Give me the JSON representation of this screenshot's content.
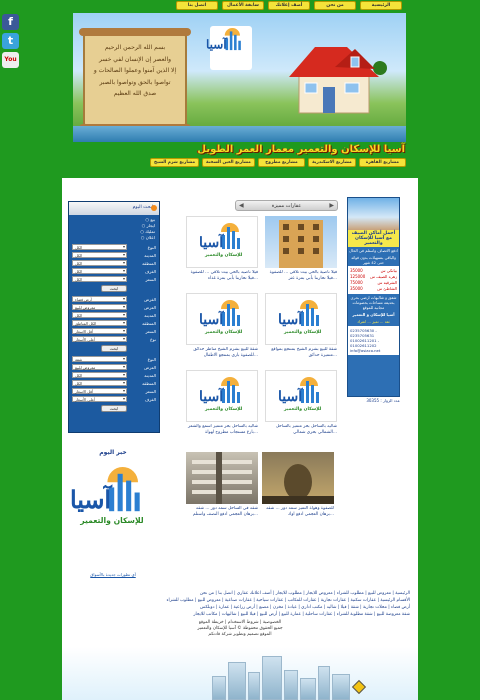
{
  "social": [
    {
      "name": "facebook-icon",
      "glyph": "f"
    },
    {
      "name": "twitter-icon",
      "glyph": "t"
    },
    {
      "name": "youtube-icon",
      "glyph": "You"
    }
  ],
  "top_nav": [
    "الرئيسية",
    "من نحن",
    "أضف إعلانك",
    "سابقة الأعمال",
    "اتصل بنا"
  ],
  "banner": {
    "scroll_text": "بسم الله الرحمن الرحيم\nوالعصر إن الإنسان لفي خسر\nإلا الذين آمنوا وعملوا الصالحات و\nتواصوا بالحق وتواصوا بالصبر\nصدق الله العظيم"
  },
  "tagline": "آسيا للإسكان والتعمير معمار العمر الطويل",
  "project_nav": [
    "مشاريع القاهرة",
    "مشاريع الاسكندرية",
    "مشاريع مطروح",
    "مشاريع العين السخنة",
    "مشاريع شرم الشيخ"
  ],
  "ad": {
    "headline": "أجمل أماكن الصيف مع آسيا للإسكان والتعمير",
    "line1": "ادفع الاتصاف واستلم في الحال",
    "line2": "والباقي بتسهيلات بدون فوائد حتى 42 شهر",
    "prices": [
      {
        "label": "بيانكي س",
        "value": "35000"
      },
      {
        "label": "زهره الصيف س",
        "value": "125000"
      },
      {
        "label": "الشرقيه س",
        "value": "75000"
      },
      {
        "label": "الشاطئ س",
        "value": "35000"
      }
    ],
    "line3": "شقق و شاليهات ارضي بحري بحديقه مساحات بخصومات مجانيه للموقع",
    "company": "آسيا للإسكان و التعمير",
    "motto": "ثقة ... تميز ... انفراد",
    "phones": [
      "0235705630 - 0235705631",
      "01002611201 - 01002611202",
      "info@asiaco.net"
    ]
  },
  "visitors": "عدد الزوار : 30355",
  "listings": {
    "title": "عقارات مميزة",
    "cards": [
      {
        "type": "building",
        "caption": "فيلا ناصية بالحي بيت نلاقي ... للصفوة فيلا تحاربنا بأبي بمرة عثر..."
      },
      {
        "type": "logo",
        "caption": "فيلا ناصيه بالحي بيت نلاقي ... للصفوة فيلا تحاربنا بأبي بمرة غذاء..."
      },
      {
        "type": "logo",
        "caption": "شقة للبيع بشرم الشيخ بمنتجع بمواقع متميزة حدائق..."
      },
      {
        "type": "logo",
        "caption": "شقة للبيع بشرم الشيخ مناظر حدائق للصفوة باري بمنتجع الاطفال..."
      },
      {
        "type": "logo",
        "caption": "شاليه بالساحل بحر متميز بالساحل الشمالي بحري شمالي..."
      },
      {
        "type": "logo",
        "caption": "شاليه بالساحل بحر متميز اسمع والشعر بارع مستجاب مطروح لهواة..."
      },
      {
        "type": "interior",
        "caption": "للصفوة وهواة التميز سمه دور ... شقه برهان العجمي ادفع اوك..."
      },
      {
        "type": "stairs",
        "caption": "شقه في الساحل سمه دور ... شقه برهان العجمي ادفع النصف واستلم..."
      }
    ]
  },
  "logo": {
    "mark": "آسيا",
    "subtitle": "للإسكان والتعمير"
  },
  "search": {
    "title": "ابحث اليوم",
    "radios": [
      "بيع",
      "ايجار",
      "تمليك",
      "اعلان"
    ],
    "rows1": [
      {
        "label": "النوع",
        "value": "الكل"
      },
      {
        "label": "المدينة",
        "value": "الكل"
      },
      {
        "label": "المنطقة",
        "value": "الكل"
      },
      {
        "label": "الغرف",
        "value": "الكل"
      },
      {
        "label": "السعر",
        "value": "الكل"
      }
    ],
    "button": "ابحث",
    "rows2": [
      {
        "label": "الغرض",
        "value": "أرض فضاء"
      },
      {
        "label": "العرض",
        "value": "معروض للبيع"
      },
      {
        "label": "المدينة",
        "value": "الكل"
      },
      {
        "label": "المنطقة",
        "value": "الكل المناطق"
      },
      {
        "label": "السعر",
        "value": "أقل الاسعار"
      },
      {
        "label": "نوع",
        "value": "أعلى الأسعار"
      }
    ],
    "rows3": [
      {
        "label": "النوع",
        "value": "شقة"
      },
      {
        "label": "العرض",
        "value": "معروض للبيع"
      },
      {
        "label": "المدينة",
        "value": "الكل"
      },
      {
        "label": "المنطقة",
        "value": "الكل"
      },
      {
        "label": "السعر",
        "value": "أقل الاسعار"
      },
      {
        "label": "الغرف",
        "value": "أعلى الأسعار"
      }
    ]
  },
  "deal": {
    "title": "خبر اليوم",
    "link": "أي تطورات جديدة بالأسواق"
  },
  "footer": {
    "links_line1": "الرئيسية | معروض للبيع | مطلوب للشراء | معروض للايجار | مطلوب للايجار | أضف اعلانك عقاري | اتصل بنا | من نحن",
    "links_line2": "الأقسام الرئيسية | عقارات سكنية | عقارات تجارية | عقارات للمكاتب | عقارات سياحية | عقارات صناعية | معروض للبيع | مطلوب للشراء",
    "links_line3": "أرض فضاء | محلات تجارية | شقة | فيلا | شاليه | مكتب اداري | عيادة | مخزن | مصنع | أرض زراعية | عمارة | دوبلكس",
    "links_line4": "شقة معروضة للبيع | شقة مطلوبة للشراء | عقارات ساحلية | عمارة للبيع | أرض للبيع | فيلا للبيع | شاليهات | مكاتب للايجار",
    "copy1": "الخصوصية | شروط الاستخدام | خريطة الموقع",
    "copy2": "جميع الحقوق محفوظة © آسيا للإسكان والتعمير",
    "copy3": "الموقع تصميم وتطوير شركة قادتكم"
  }
}
